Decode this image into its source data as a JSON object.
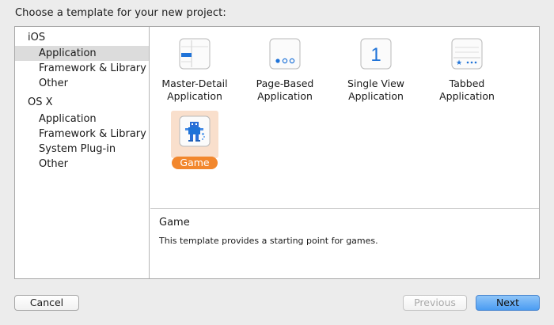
{
  "header": {
    "title": "Choose a template for your new project:"
  },
  "sidebar": {
    "ios_header": "iOS",
    "ios_items": [
      "Application",
      "Framework & Library",
      "Other"
    ],
    "osx_header": "OS X",
    "osx_items": [
      "Application",
      "Framework & Library",
      "System Plug-in",
      "Other"
    ],
    "selected": "iOS / Application"
  },
  "templates": [
    {
      "line1": "Master-Detail",
      "line2": "Application",
      "icon": "master-detail-icon"
    },
    {
      "line1": "Page-Based",
      "line2": "Application",
      "icon": "page-based-icon"
    },
    {
      "line1": "Single View",
      "line2": "Application",
      "icon": "single-view-icon",
      "glyph": "1"
    },
    {
      "line1": "Tabbed",
      "line2": "Application",
      "icon": "tabbed-icon"
    },
    {
      "label": "Game",
      "icon": "game-icon",
      "selected": true
    }
  ],
  "description": {
    "title": "Game",
    "text": "This template provides a starting point for games."
  },
  "buttons": {
    "cancel": "Cancel",
    "previous": "Previous",
    "next": "Next"
  },
  "colors": {
    "accent": "#f2872d",
    "selection_bg": "#f9dfcc",
    "primary_button": "#4a9cf2",
    "icon_blue": "#1f73d8"
  }
}
